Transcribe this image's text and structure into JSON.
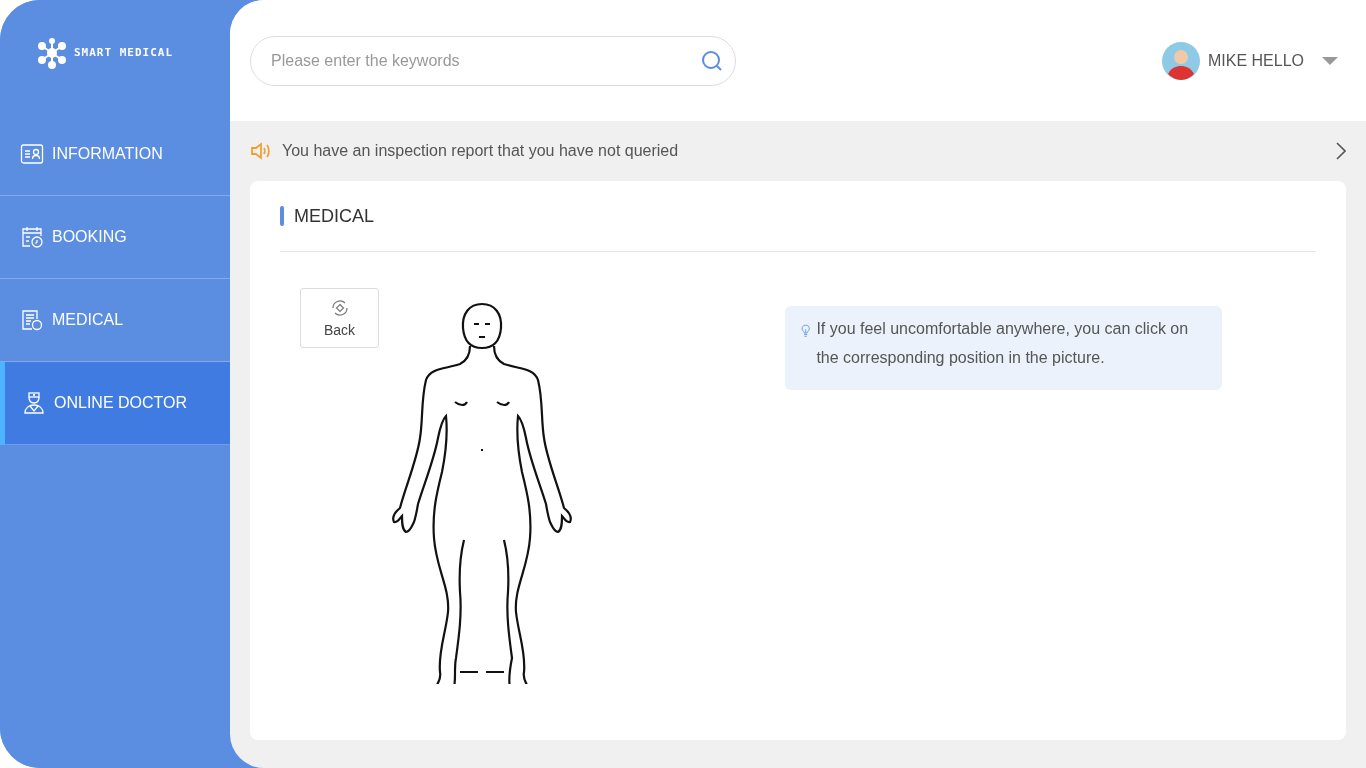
{
  "sidebar": {
    "logo_text": "SMART MEDICAL",
    "items": [
      {
        "label": "INFORMATION",
        "kind": "card",
        "selected": false
      },
      {
        "label": "BOOKING",
        "kind": "calendar",
        "selected": false
      },
      {
        "label": "MEDICAL",
        "kind": "report",
        "selected": false
      },
      {
        "label": "ONLINE DOCTOR",
        "kind": "doctor",
        "selected": true
      }
    ]
  },
  "header": {
    "search": {
      "placeholder": "Please enter the keywords"
    },
    "user": {
      "name": "MIKE HELLO"
    }
  },
  "notice": {
    "text": "You have an inspection report that you have not queried"
  },
  "panel": {
    "title": "MEDICAL",
    "back_button": "Back",
    "hint": "If you feel uncomfortable anywhere, you can click on the corresponding position in the picture."
  }
}
